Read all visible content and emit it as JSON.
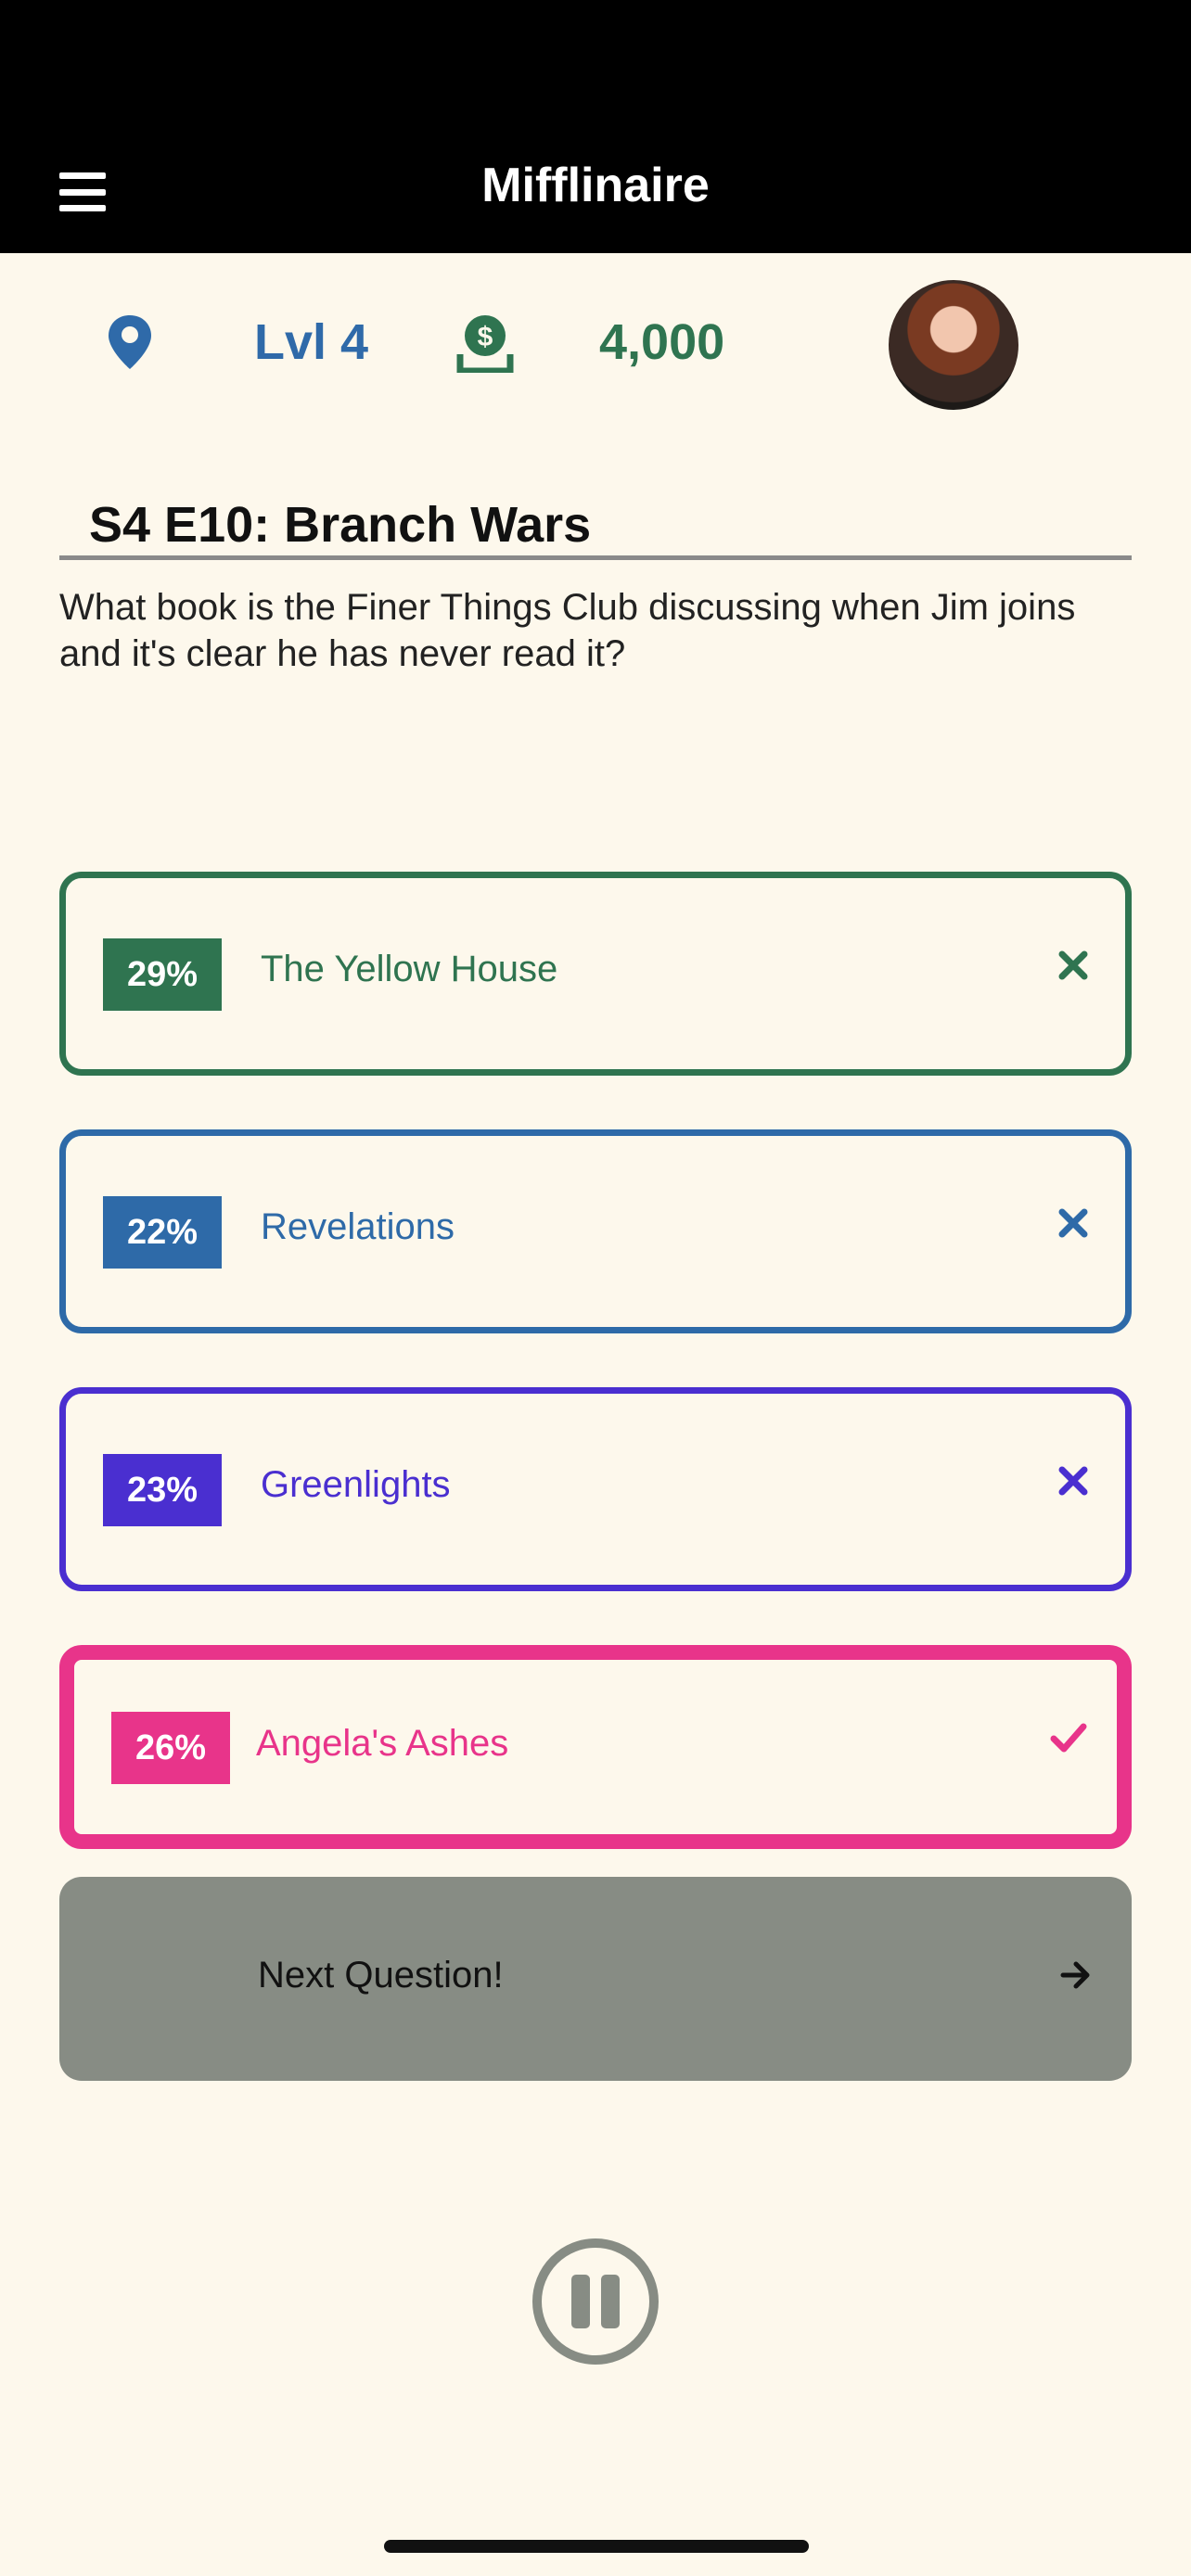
{
  "header": {
    "title": "Mifflinaire",
    "menu_icon": "hamburger-menu-icon"
  },
  "stats": {
    "level_label": "Lvl 4",
    "coins": "4,000",
    "level_icon": "location-pin-icon",
    "coins_icon": "money-icon"
  },
  "question": {
    "episode": "S4 E10: Branch Wars",
    "text": "What book is the Finer Things Club discussing when Jim joins and it's clear he has never read it?"
  },
  "answers": [
    {
      "percent": "29%",
      "label": "The Yellow House",
      "color": "#2f7450",
      "result": "incorrect"
    },
    {
      "percent": "22%",
      "label": "Revelations",
      "color": "#2e6aa8",
      "result": "incorrect"
    },
    {
      "percent": "23%",
      "label": "Greenlights",
      "color": "#4a2fd0",
      "result": "incorrect"
    },
    {
      "percent": "26%",
      "label": "Angela's Ashes",
      "color": "#e8348a",
      "result": "correct"
    }
  ],
  "next": {
    "label": "Next Question!"
  },
  "colors": {
    "background": "#fdf8ec",
    "next_button": "#878c84",
    "pause": "#878c84"
  }
}
